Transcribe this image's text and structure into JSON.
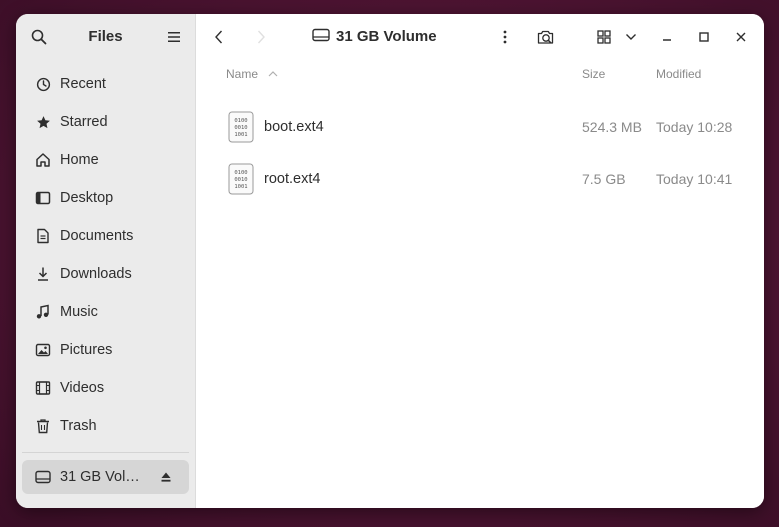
{
  "sidebar": {
    "title": "Files",
    "items": [
      {
        "label": "Recent",
        "icon": "clock-icon"
      },
      {
        "label": "Starred",
        "icon": "star-icon"
      },
      {
        "label": "Home",
        "icon": "home-icon"
      },
      {
        "label": "Desktop",
        "icon": "desktop-icon"
      },
      {
        "label": "Documents",
        "icon": "document-icon"
      },
      {
        "label": "Downloads",
        "icon": "download-icon"
      },
      {
        "label": "Music",
        "icon": "music-icon"
      },
      {
        "label": "Pictures",
        "icon": "picture-icon"
      },
      {
        "label": "Videos",
        "icon": "video-icon"
      },
      {
        "label": "Trash",
        "icon": "trash-icon"
      }
    ],
    "volume": {
      "label": "31 GB Volume",
      "icon": "drive-icon",
      "eject_icon": "eject-icon"
    }
  },
  "header": {
    "location": "31 GB Volume"
  },
  "columns": {
    "name": "Name",
    "size": "Size",
    "modified": "Modified"
  },
  "files": [
    {
      "name": "boot.ext4",
      "size": "524.3 MB",
      "modified": "Today 10:28",
      "icon": "binary-file-icon"
    },
    {
      "name": "root.ext4",
      "size": "7.5 GB",
      "modified": "Today 10:41",
      "icon": "binary-file-icon"
    }
  ],
  "colors": {
    "accent": "#2e2e2e",
    "sidebar_bg": "#ebebeb",
    "selected_bg": "#d6d6d6",
    "desktop_bg": "#4d1432"
  }
}
